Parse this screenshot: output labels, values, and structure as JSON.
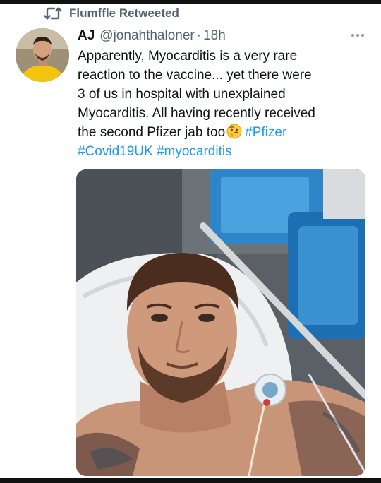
{
  "retweet": {
    "icon": "retweet-icon",
    "label": "Flumffle Retweeted"
  },
  "tweet": {
    "author_name": "AJ",
    "handle": "@jonahthaloner",
    "separator": "·",
    "time": "18h",
    "more_icon": "more-horizontal-icon",
    "text_lines": [
      "Apparently, Myocarditis is a very rare",
      "reaction to the vaccine... yet there were",
      "3 of us in hospital with unexplained",
      "Myocarditis. All having recently received",
      "the second Pfizer jab too"
    ],
    "emoji": "thinking-face-emoji",
    "hashtags": [
      "#Pfizer",
      "#Covid19UK",
      "#myocarditis"
    ],
    "hashtag_color": "#1d9bf0",
    "text_color": "#0f1419",
    "muted_color": "#536471"
  }
}
